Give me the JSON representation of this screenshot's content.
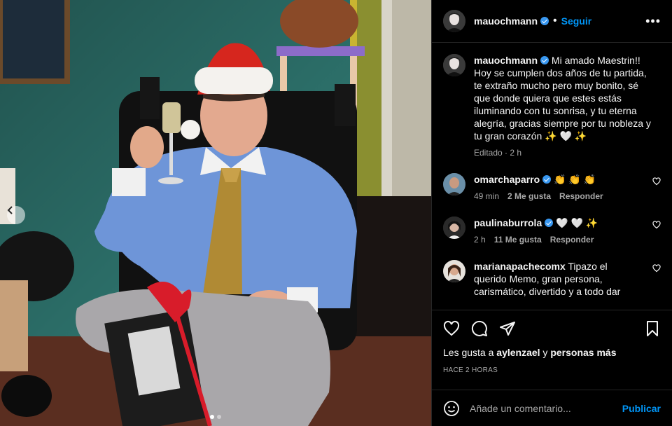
{
  "header": {
    "username": "mauochmann",
    "dot": "•",
    "follow_label": "Seguir"
  },
  "caption": {
    "username": "mauochmann",
    "text": "Mi amado Maestrin!! Hoy se cumplen dos años de tu partida, te extraño mucho pero muy bonito, sé que donde quiera que estes estás iluminando con tu sonrisa, y tu eterna alegría, gracias siempre por tu nobleza y tu gran corazón ✨ 🤍 ✨",
    "meta": "Editado · 2 h"
  },
  "comments": [
    {
      "username": "omarchaparro",
      "text": "👏 👏 👏",
      "time": "49 min",
      "likes": "2 Me gusta",
      "reply": "Responder"
    },
    {
      "username": "paulinaburrola",
      "text": "🤍 🤍 ✨",
      "time": "2 h",
      "likes": "11 Me gusta",
      "reply": "Responder"
    },
    {
      "username": "marianapachecomx",
      "text": "Tipazo el querido Memo, gran persona, carismático, divertido y a todo dar"
    }
  ],
  "likes_line": {
    "prefix": "Les gusta a ",
    "user": "aylenzael",
    "mid": " y ",
    "rest": "personas más"
  },
  "timestamp": "HACE 2 HORAS",
  "composer": {
    "placeholder": "Añade un comentario...",
    "publish_label": "Publicar"
  },
  "carousel": {
    "dots": 2,
    "active": 0
  },
  "colors": {
    "accent": "#0095f6",
    "verified": "#3897f0",
    "background": "#000000"
  }
}
